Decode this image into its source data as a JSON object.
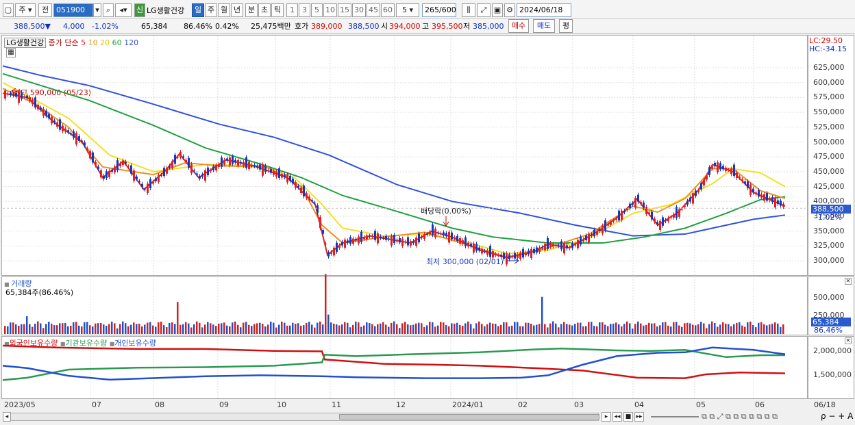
{
  "toolbar": {
    "period_type": "주",
    "prev_label": "전",
    "code": "051900",
    "stock_name_badge": "신",
    "stock_name": "LG생활건강",
    "periods": [
      "일",
      "주",
      "월",
      "년",
      "분",
      "초",
      "틱"
    ],
    "active_period": "일",
    "intervals": [
      "1",
      "3",
      "5",
      "10",
      "15",
      "30",
      "45",
      "60"
    ],
    "interval_value": "5",
    "count": "265",
    "count_total": "/600",
    "date": "2024/06/18"
  },
  "quote": {
    "price": "388,500",
    "change_arrow": "▼",
    "change": "4,000",
    "change_pct": "-1.02%",
    "volume": "65,384",
    "volume_ratio": "86.46%",
    "turnover": "0.42%",
    "amount": "25,475백만",
    "bid_label": "호가",
    "bid": "389,000",
    "ask": "388,500",
    "open_label": "시",
    "open": "394,000",
    "high_label": "고",
    "high": "395,500",
    "low_label": "저",
    "low": "385,000",
    "buy_label": "매수",
    "sell_label": "매도",
    "eval_label": "평"
  },
  "price_panel": {
    "stock_tag": "LG생활건강",
    "ma_label": "종가 단순",
    "ma_periods": [
      "5",
      "10",
      "20",
      "60",
      "120"
    ],
    "ma_colors": [
      "#e02020",
      "#f0901a",
      "#f4e020",
      "#20a040",
      "#3050e0"
    ],
    "lc": "LC:29.50",
    "hc": "HC:-34.15",
    "high_note": "최고 590,000 (05/23)",
    "low_note": "최저 300,000 (02/01)",
    "div_note": "배당락(0.00%)",
    "current_badge": "388,500",
    "current_pct": "-1.02%",
    "y_ticks": [
      "625,000",
      "600,000",
      "575,000",
      "550,000",
      "525,000",
      "500,000",
      "475,000",
      "450,000",
      "425,000",
      "400,000",
      "375,000",
      "350,000",
      "325,000",
      "300,000"
    ]
  },
  "volume_panel": {
    "title": "거래량",
    "value": "65,384주(86.46%)",
    "y_ticks": [
      "500,000",
      "250,000"
    ],
    "badge": "65,384",
    "badge_pct": "86.46%"
  },
  "holdings_panel": {
    "legend": [
      "외국인보유수량",
      "기관보유수량",
      "개인보유수량"
    ],
    "colors": [
      "#d01010",
      "#2a9a50",
      "#2050d0"
    ],
    "y_ticks": [
      "2,000,000",
      "1,500,000"
    ]
  },
  "x_labels": [
    "2023/05",
    "07",
    "08",
    "09",
    "10",
    "11",
    "12",
    "2024/01",
    "02",
    "03",
    "04",
    "05",
    "06",
    "06/18"
  ]
}
